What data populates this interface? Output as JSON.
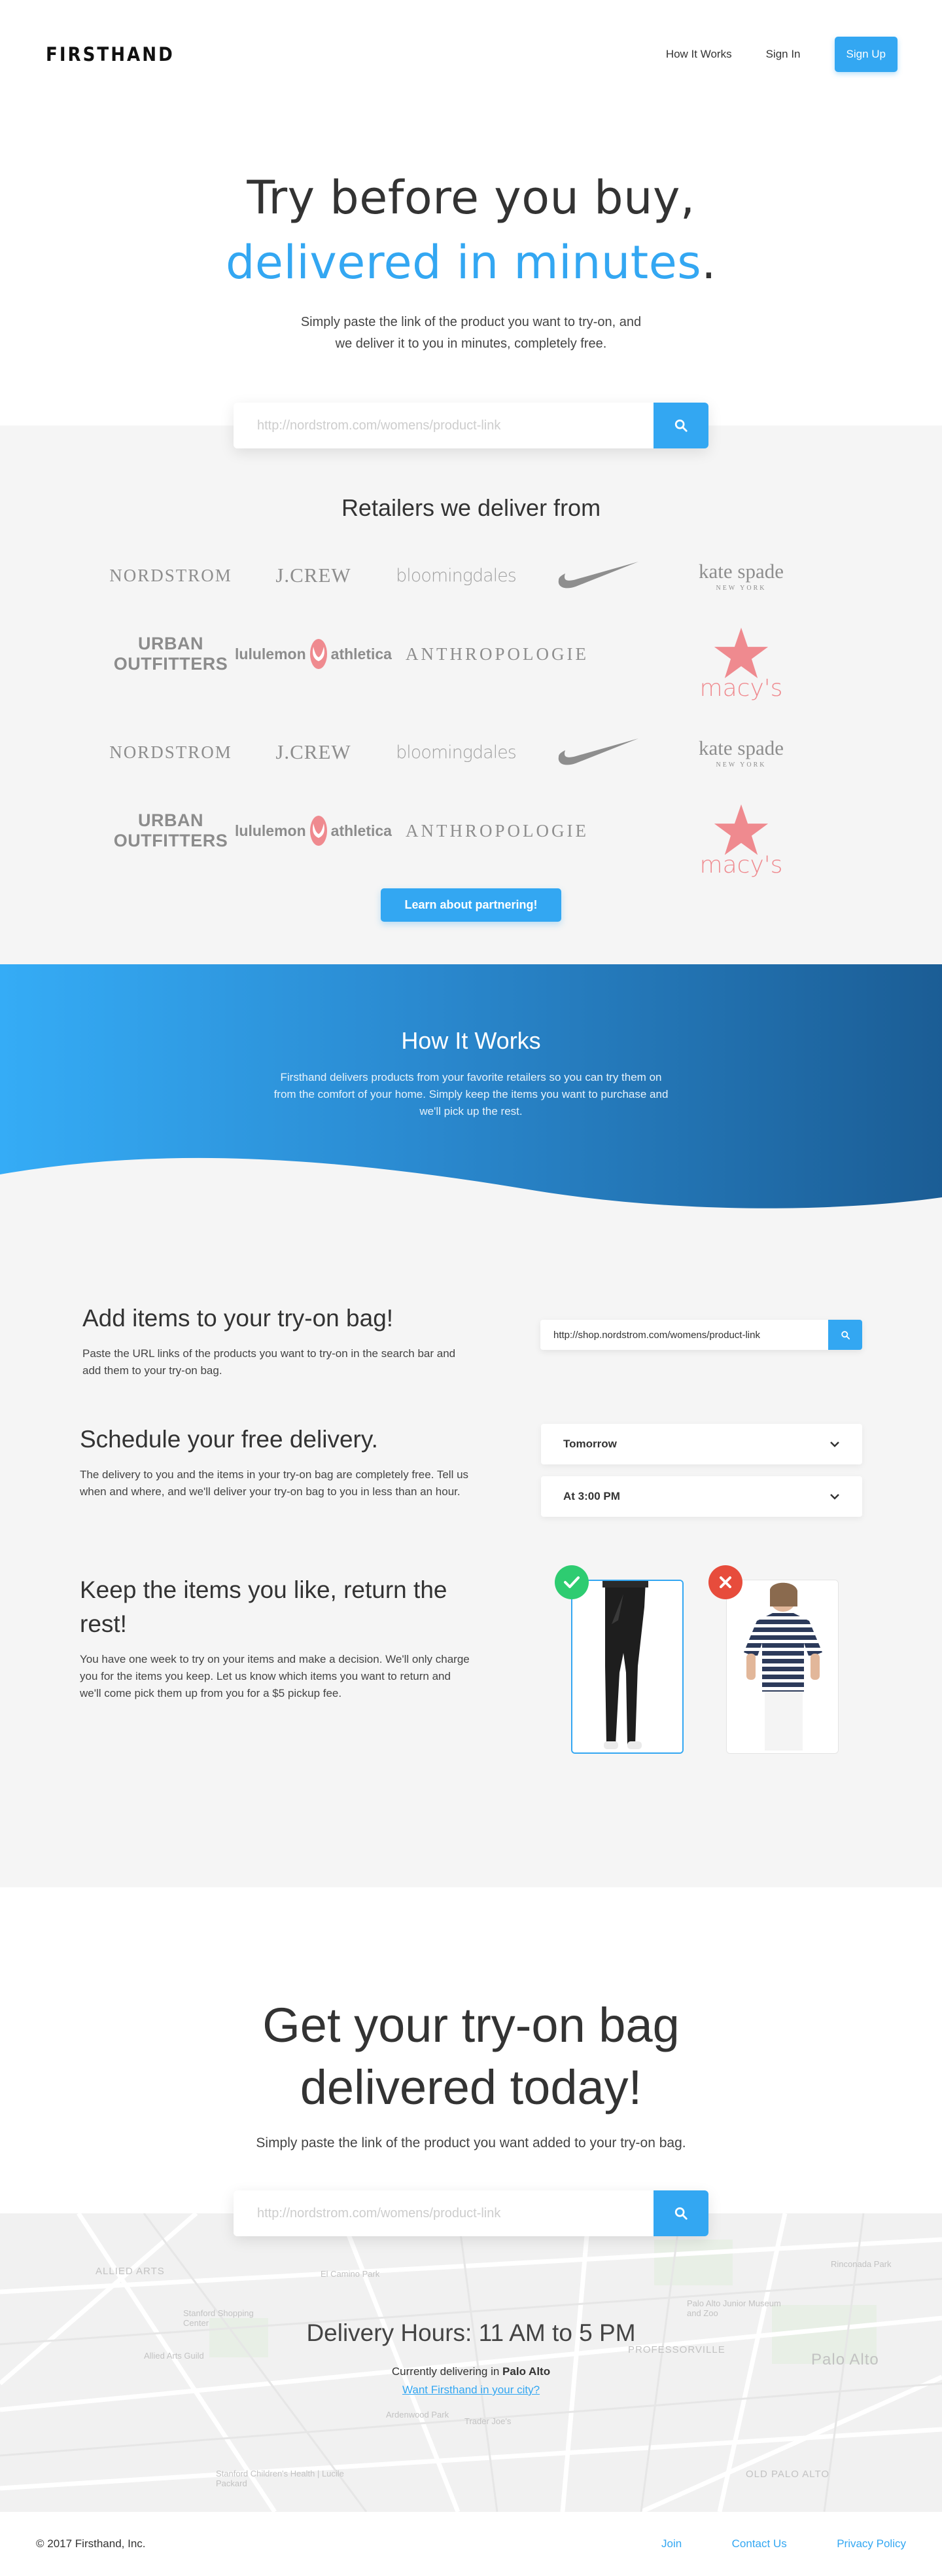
{
  "nav": {
    "logo": "FIRSTHAND",
    "links": [
      "How It Works",
      "Sign In"
    ],
    "signup": "Sign Up"
  },
  "hero": {
    "title_line1": "Try before you buy,",
    "title_line2_blue": "delivered in minutes",
    "title_line2_end": ".",
    "subtitle_line1": "Simply paste the link of the product you want to try-on, and",
    "subtitle_line2": "we deliver it to you in minutes, completely free.",
    "search_placeholder": "http://nordstrom.com/womens/product-link"
  },
  "retailers": {
    "title": "Retailers we deliver from",
    "logos": {
      "nordstrom": "NORDSTROM",
      "jcrew": "J.CREW",
      "bloomingdales": "bloomingdales",
      "kate": "kate spade",
      "kate_sub": "NEW YORK",
      "urban": "URBAN OUTFITTERS",
      "lulu_a": "lululemon",
      "lulu_b": "athletica",
      "anthro": "ANTHROPOLOGIE",
      "macys": "macy's"
    },
    "cta": "Learn about partnering!"
  },
  "how": {
    "title": "How It Works",
    "description": "Firsthand delivers products from your favorite retailers so you can try them on from the comfort of your home. Simply keep the items you want to purchase and we'll pick up the rest."
  },
  "steps": {
    "add": {
      "title": "Add items to your try-on bag!",
      "text": "Paste the URL links of the products you want to try-on in the search bar and add them to your try-on bag.",
      "search_value": "http://shop.nordstrom.com/womens/product-link"
    },
    "schedule": {
      "title": "Schedule your free delivery.",
      "text": "The delivery to you and the items in your try-on bag are completely free. Tell us when and where, and we'll deliver your try-on bag to you in less than an hour.",
      "day": "Tomorrow",
      "time": "At 3:00 PM"
    },
    "keep": {
      "title_line1": "Keep the items you like, return the",
      "title_line2": "rest!",
      "text": "You have one week to try on your items and make a decision. We'll only charge you for the items you keep. Let us know which items you want to return and we'll come pick them up from you for a $5 pickup fee."
    }
  },
  "cta": {
    "title_line1": "Get your try-on bag",
    "title_line2": "delivered today!",
    "subtitle": "Simply paste the link of the product you want added to your try-on bag.",
    "search_placeholder": "http://nordstrom.com/womens/product-link"
  },
  "map": {
    "labels": [
      "ALLIED ARTS",
      "PROFESSORVILLE",
      "OLD PALO ALTO",
      "Stanford Shopping Center",
      "Allied Arts Guild",
      "El Camino Park",
      "Palo Alto Junior Museum and Zoo",
      "Rinconada Park",
      "Trader Joe's",
      "Stanford Children's Health | Lucile Packard",
      "Palo Alto",
      "Ardenwood Park"
    ],
    "hours": "Delivery Hours: 11 AM to 5 PM",
    "currently": "Currently delivering in",
    "city": "Palo Alto",
    "link": "Want Firsthand in your city?"
  },
  "footer": {
    "copyright": "© 2017 Firsthand, Inc.",
    "links": [
      "Join",
      "Contact Us",
      "Privacy Policy"
    ]
  },
  "colors": {
    "accent": "#33a7f2",
    "background_gray": "#f5f5f5",
    "logo_pink": "#ef8a8f",
    "check_green": "#2ecc71",
    "cross_red": "#e74c3c"
  }
}
